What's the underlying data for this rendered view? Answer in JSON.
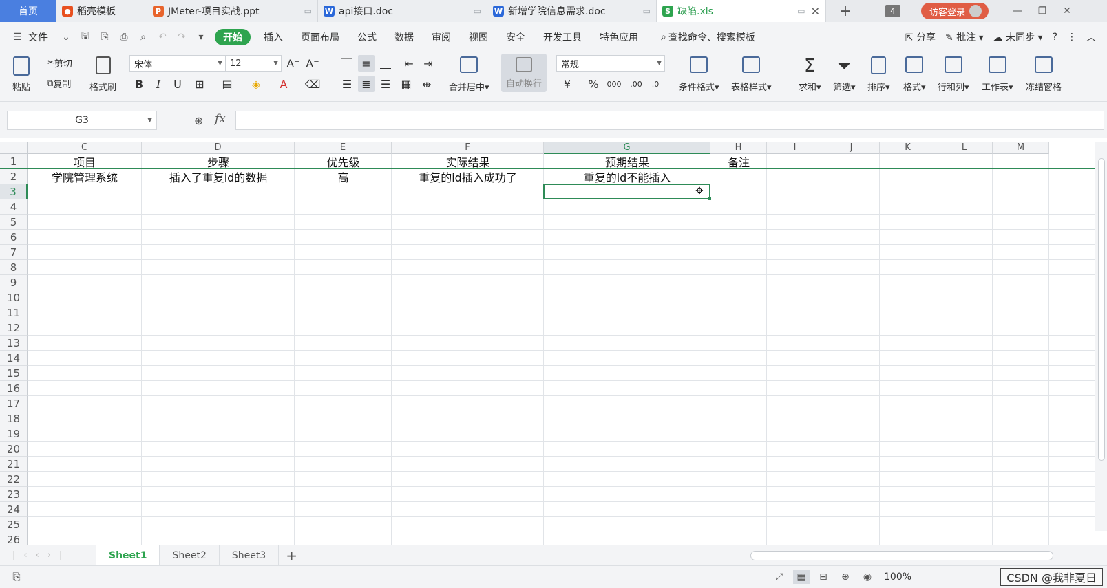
{
  "tabs": {
    "home": "首页",
    "items": [
      {
        "label": "稻壳模板",
        "icon": "daoke-icon",
        "color": "#e8501f"
      },
      {
        "label": "JMeter-项目实战.ppt",
        "icon": "ppt-icon",
        "color": "#e8642c"
      },
      {
        "label": "api接口.doc",
        "icon": "word-icon",
        "color": "#2b68d9"
      },
      {
        "label": "新增学院信息需求.doc",
        "icon": "word-icon",
        "color": "#2b68d9"
      },
      {
        "label": "缺陷.xls",
        "icon": "sheet-icon",
        "color": "#2ea44f"
      }
    ],
    "count": "4",
    "login": "访客登录"
  },
  "menu": {
    "file": "文件",
    "items": [
      "开始",
      "插入",
      "页面布局",
      "公式",
      "数据",
      "审阅",
      "视图",
      "安全",
      "开发工具",
      "特色应用"
    ],
    "search": "查找命令、搜索模板",
    "share": "分享",
    "comment": "批注",
    "sync": "未同步",
    "help": "?"
  },
  "ribbon": {
    "paste": "粘贴",
    "cut": "剪切",
    "copy": "复制",
    "format_painter": "格式刷",
    "font_name": "宋体",
    "font_size": "12",
    "merge_center": "合并居中",
    "wrap_text": "自动换行",
    "number_format": "常规",
    "conditional_format": "条件格式",
    "table_style": "表格样式",
    "sum": "求和",
    "filter": "筛选",
    "sort": "排序",
    "format": "格式",
    "row_col": "行和列",
    "worksheet": "工作表",
    "freeze": "冻结窗格"
  },
  "formula_bar": {
    "name_box": "G3",
    "fx": "fx",
    "value": ""
  },
  "sheet": {
    "columns": [
      {
        "label": "C",
        "w": 166
      },
      {
        "label": "D",
        "w": 222
      },
      {
        "label": "E",
        "w": 141
      },
      {
        "label": "F",
        "w": 221
      },
      {
        "label": "G",
        "w": 242
      },
      {
        "label": "H",
        "w": 82
      },
      {
        "label": "I",
        "w": 82
      },
      {
        "label": "J",
        "w": 82
      },
      {
        "label": "K",
        "w": 82
      },
      {
        "label": "L",
        "w": 82
      },
      {
        "label": "M",
        "w": 82
      }
    ],
    "selected_col": "G",
    "selected_row": 3,
    "row_count": 26,
    "rows": [
      [
        "项目",
        "步骤",
        "优先级",
        "实际结果",
        "预期结果",
        "备注"
      ],
      [
        "学院管理系统",
        "插入了重复id的数据",
        "高",
        "重复的id插入成功了",
        "重复的id不能插入",
        ""
      ]
    ]
  },
  "sheet_tabs": [
    "Sheet1",
    "Sheet2",
    "Sheet3"
  ],
  "status": {
    "zoom": "100%",
    "watermark": "CSDN @我非夏日"
  }
}
